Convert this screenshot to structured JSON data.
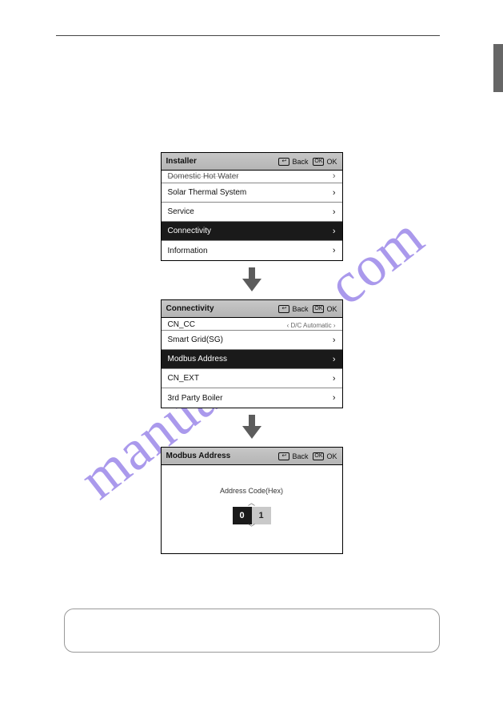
{
  "watermark": "manualshive.com",
  "panels": {
    "installer": {
      "title": "Installer",
      "back": "Back",
      "ok": "OK",
      "rows": {
        "dhw": "Domestic Hot Water",
        "solar": "Solar Thermal System",
        "service": "Service",
        "connectivity": "Connectivity",
        "information": "Information"
      }
    },
    "connectivity": {
      "title": "Connectivity",
      "back": "Back",
      "ok": "OK",
      "rows": {
        "cncc": "CN_CC",
        "cncc_sub": "D/C Automatic",
        "smartgrid": "Smart Grid(SG)",
        "modbus": "Modbus Address",
        "cnext": "CN_EXT",
        "thirdparty": "3rd Party Boiler"
      }
    },
    "modbus": {
      "title": "Modbus Address",
      "back": "Back",
      "ok": "OK",
      "label": "Address Code(Hex)",
      "digit0": "0",
      "digit1": "1"
    }
  }
}
